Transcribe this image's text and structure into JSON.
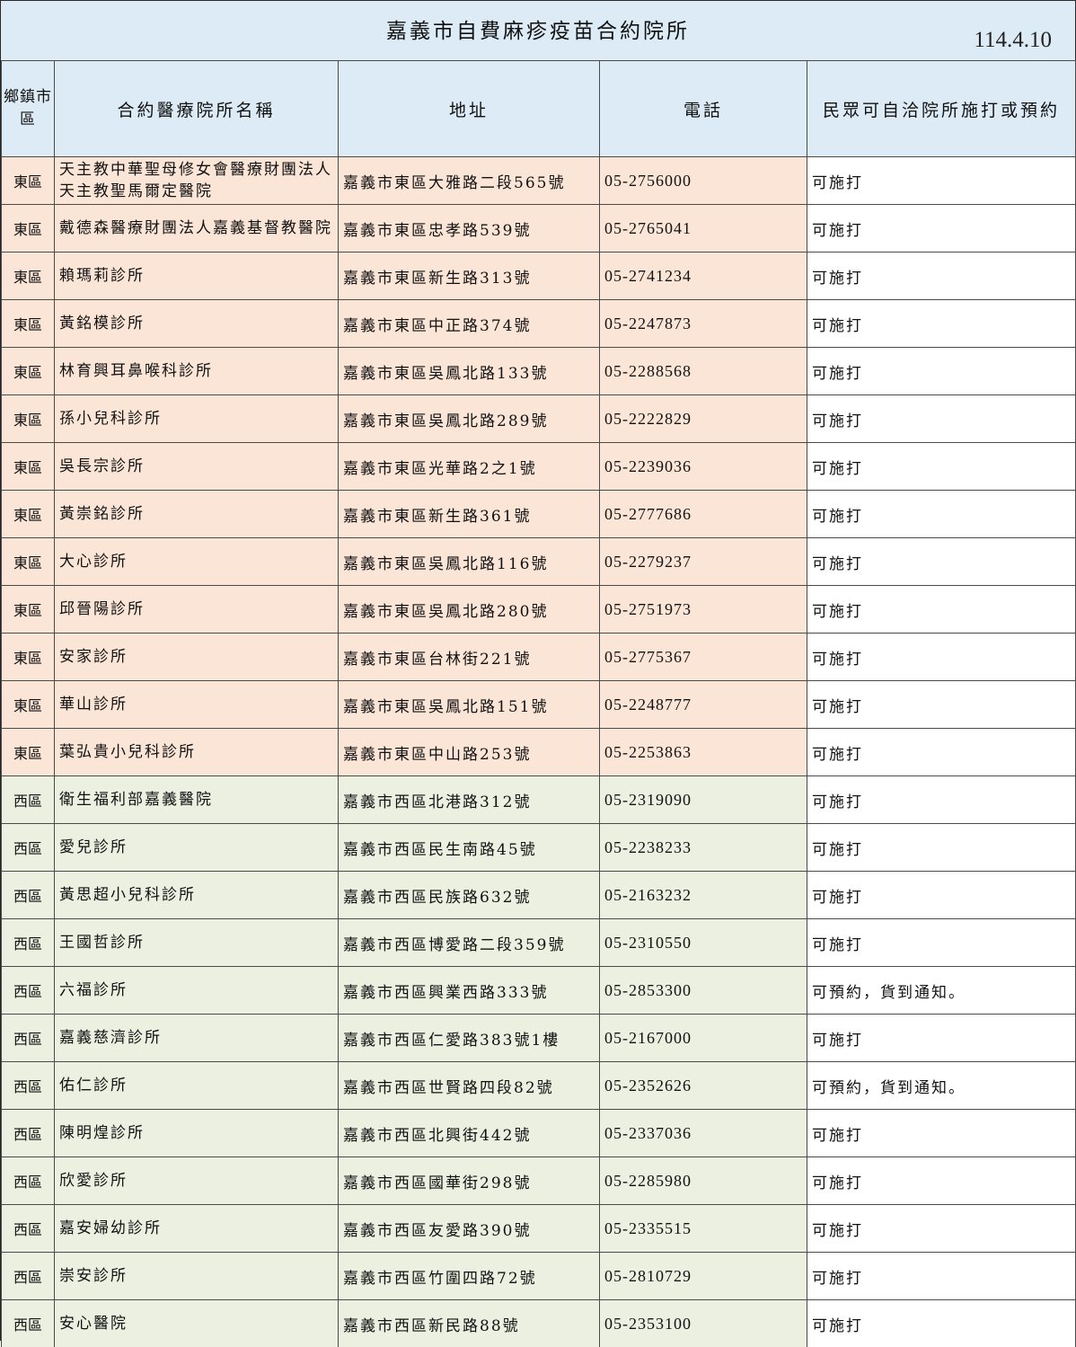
{
  "document": {
    "title": "嘉義市自費麻疹疫苗合約院所",
    "date": "114.4.10"
  },
  "table": {
    "headers": {
      "district": "鄉鎮市區",
      "name": "合約醫療院所名稱",
      "address": "地址",
      "phone": "電話",
      "note": "民眾可自洽院所施打或預約"
    },
    "rows": [
      {
        "district": "東區",
        "name": "天主教中華聖母修女會醫療財團法人天主教聖馬爾定醫院",
        "address": "嘉義市東區大雅路二段565號",
        "phone": "05-2756000",
        "note": "可施打",
        "group": "east"
      },
      {
        "district": "東區",
        "name": "戴德森醫療財團法人嘉義基督教醫院",
        "address": "嘉義市東區忠孝路539號",
        "phone": "05-2765041",
        "note": "可施打",
        "group": "east"
      },
      {
        "district": "東區",
        "name": "賴瑪莉診所",
        "address": "嘉義市東區新生路313號",
        "phone": "05-2741234",
        "note": "可施打",
        "group": "east"
      },
      {
        "district": "東區",
        "name": "黃銘模診所",
        "address": "嘉義市東區中正路374號",
        "phone": "05-2247873",
        "note": "可施打",
        "group": "east"
      },
      {
        "district": "東區",
        "name": "林育興耳鼻喉科診所",
        "address": "嘉義市東區吳鳳北路133號",
        "phone": "05-2288568",
        "note": "可施打",
        "group": "east"
      },
      {
        "district": "東區",
        "name": "孫小兒科診所",
        "address": "嘉義市東區吳鳳北路289號",
        "phone": "05-2222829",
        "note": "可施打",
        "group": "east"
      },
      {
        "district": "東區",
        "name": "吳長宗診所",
        "address": "嘉義市東區光華路2之1號",
        "phone": "05-2239036",
        "note": "可施打",
        "group": "east"
      },
      {
        "district": "東區",
        "name": "黃崇銘診所",
        "address": "嘉義市東區新生路361號",
        "phone": "05-2777686",
        "note": "可施打",
        "group": "east"
      },
      {
        "district": "東區",
        "name": "大心診所",
        "address": "嘉義市東區吳鳳北路116號",
        "phone": "05-2279237",
        "note": "可施打",
        "group": "east"
      },
      {
        "district": "東區",
        "name": "邱晉陽診所",
        "address": "嘉義市東區吳鳳北路280號",
        "phone": "05-2751973",
        "note": "可施打",
        "group": "east"
      },
      {
        "district": "東區",
        "name": "安家診所",
        "address": "嘉義市東區台林街221號",
        "phone": "05-2775367",
        "note": "可施打",
        "group": "east"
      },
      {
        "district": "東區",
        "name": "華山診所",
        "address": "嘉義市東區吳鳳北路151號",
        "phone": "05-2248777",
        "note": "可施打",
        "group": "east"
      },
      {
        "district": "東區",
        "name": "葉弘貴小兒科診所",
        "address": "嘉義市東區中山路253號",
        "phone": "05-2253863",
        "note": "可施打",
        "group": "east"
      },
      {
        "district": "西區",
        "name": "衛生福利部嘉義醫院",
        "address": "嘉義市西區北港路312號",
        "phone": "05-2319090",
        "note": "可施打",
        "group": "west"
      },
      {
        "district": "西區",
        "name": "愛兒診所",
        "address": "嘉義市西區民生南路45號",
        "phone": "05-2238233",
        "note": "可施打",
        "group": "west"
      },
      {
        "district": "西區",
        "name": "黃思超小兒科診所",
        "address": "嘉義市西區民族路632號",
        "phone": "05-2163232",
        "note": "可施打",
        "group": "west"
      },
      {
        "district": "西區",
        "name": "王國哲診所",
        "address": "嘉義市西區博愛路二段359號",
        "phone": "05-2310550",
        "note": "可施打",
        "group": "west"
      },
      {
        "district": "西區",
        "name": "六福診所",
        "address": "嘉義市西區興業西路333號",
        "phone": "05-2853300",
        "note": "可預約，貨到通知。",
        "group": "west"
      },
      {
        "district": "西區",
        "name": "嘉義慈濟診所",
        "address": "嘉義市西區仁愛路383號1樓",
        "phone": "05-2167000",
        "note": "可施打",
        "group": "west"
      },
      {
        "district": "西區",
        "name": "佑仁診所",
        "address": "嘉義市西區世賢路四段82號",
        "phone": "05-2352626",
        "note": "可預約，貨到通知。",
        "group": "west"
      },
      {
        "district": "西區",
        "name": "陳明煌診所",
        "address": "嘉義市西區北興街442號",
        "phone": "05-2337036",
        "note": "可施打",
        "group": "west"
      },
      {
        "district": "西區",
        "name": "欣愛診所",
        "address": "嘉義市西區國華街298號",
        "phone": "05-2285980",
        "note": "可施打",
        "group": "west"
      },
      {
        "district": "西區",
        "name": "嘉安婦幼診所",
        "address": "嘉義市西區友愛路390號",
        "phone": "05-2335515",
        "note": "可施打",
        "group": "west"
      },
      {
        "district": "西區",
        "name": "崇安診所",
        "address": "嘉義市西區竹圍四路72號",
        "phone": "05-2810729",
        "note": "可施打",
        "group": "west"
      },
      {
        "district": "西區",
        "name": "安心醫院",
        "address": "嘉義市西區新民路88號",
        "phone": "05-2353100",
        "note": "可施打",
        "group": "west"
      }
    ]
  }
}
